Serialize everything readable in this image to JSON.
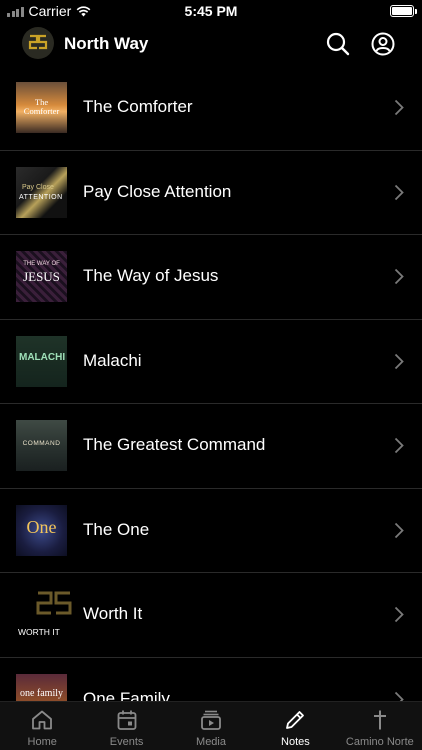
{
  "status_bar": {
    "carrier": "Carrier",
    "time": "5:45 PM"
  },
  "header": {
    "title": "North Way"
  },
  "notes": [
    {
      "title": "The Comforter"
    },
    {
      "title": "Pay Close Attention"
    },
    {
      "title": "The Way of Jesus"
    },
    {
      "title": "Malachi"
    },
    {
      "title": "The Greatest Command"
    },
    {
      "title": "The One"
    },
    {
      "title": "Worth It"
    },
    {
      "title": "One Family"
    }
  ],
  "thumbnails": {
    "comforter": "The Comforter",
    "pay_attention_1": "Pay Close",
    "pay_attention_2": "ATTENTION",
    "way_of_jesus_1": "THE WAY OF",
    "way_of_jesus_2": "JESUS",
    "malachi": "MALACHI",
    "greatest_command": "COMMAND",
    "the_one": "One",
    "worth_it": "WORTH IT",
    "one_family": "one family"
  },
  "tabs": [
    {
      "label": "Home",
      "icon": "home-icon"
    },
    {
      "label": "Events",
      "icon": "calendar-icon"
    },
    {
      "label": "Media",
      "icon": "media-icon"
    },
    {
      "label": "Notes",
      "icon": "pencil-icon",
      "active": true
    },
    {
      "label": "Camino Norte",
      "icon": "cross-icon"
    }
  ],
  "colors": {
    "background": "#000000",
    "tab_inactive": "#8a8a8a",
    "tab_active": "#ffffff",
    "separator": "#2a2a2a"
  }
}
